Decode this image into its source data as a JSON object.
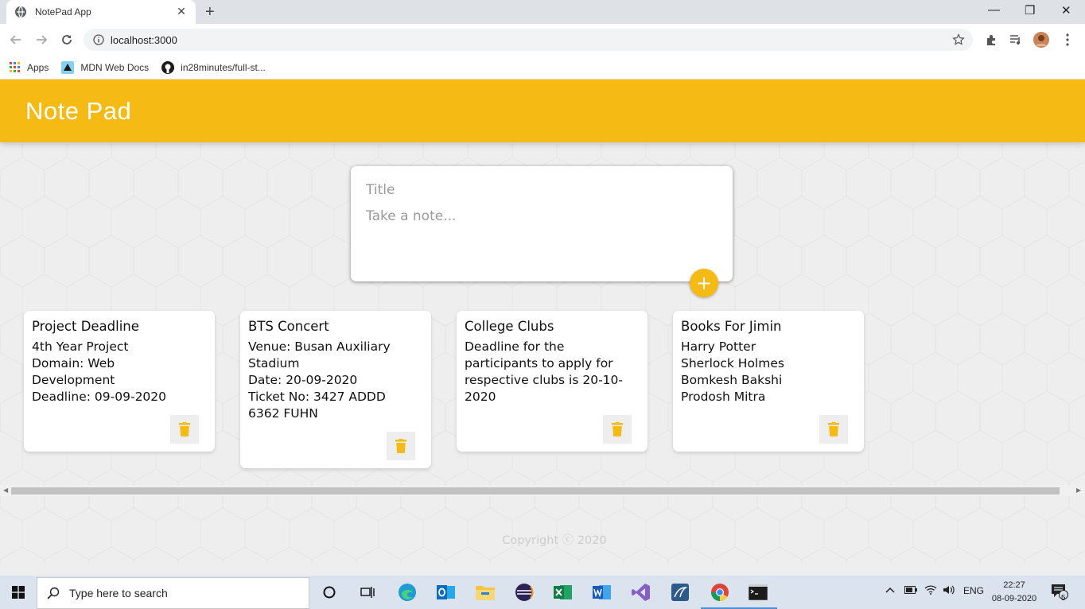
{
  "browser": {
    "tab_title": "NotePad App",
    "tab_close": "✕",
    "new_tab": "+",
    "window_controls": {
      "minimize": "—",
      "restore": "❐",
      "close": "✕"
    },
    "url": "localhost:3000",
    "bookmarks": [
      {
        "label": "Apps",
        "icon": "apps-grid-icon"
      },
      {
        "label": "MDN Web Docs",
        "icon": "mdn-icon"
      },
      {
        "label": "in28minutes/full-st...",
        "icon": "github-icon"
      }
    ]
  },
  "app": {
    "title": "Note Pad",
    "accent_color": "#f5ba13",
    "create_note": {
      "title_placeholder": "Title",
      "content_placeholder": "Take a note...",
      "add_label": "+"
    },
    "notes": [
      {
        "title": "Project Deadline",
        "content": "4th Year Project\nDomain: Web\nDevelopment\nDeadline: 09-09-2020"
      },
      {
        "title": "BTS Concert",
        "content": "Venue: Busan Auxiliary\nStadium\nDate: 20-09-2020\nTicket No: 3427 ADDD\n6362 FUHN"
      },
      {
        "title": "College Clubs",
        "content": "Deadline for the\nparticipants to apply for\nrespective clubs is 20-10-\n2020"
      },
      {
        "title": "Books For Jimin",
        "content": "Harry Potter\nSherlock Holmes\nBomkesh Bakshi\nProdosh Mitra"
      }
    ],
    "footer": "Copyright ⓒ 2020"
  },
  "taskbar": {
    "search_placeholder": "Type here to search",
    "language": "ENG",
    "time": "22:27",
    "date": "08-09-2020",
    "notification_count": "5"
  }
}
